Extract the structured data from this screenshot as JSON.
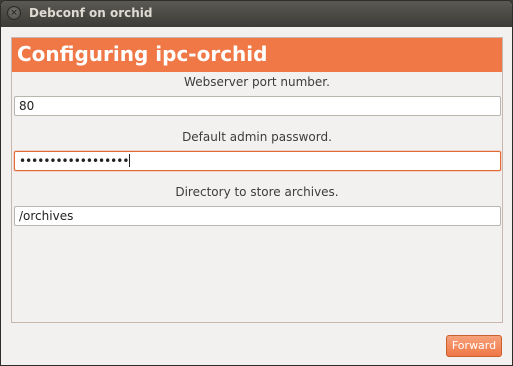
{
  "window": {
    "title": "Debconf on orchid"
  },
  "header": {
    "title": "Configuring ipc-orchid"
  },
  "fields": {
    "port": {
      "label": "Webserver port number.",
      "value": "80"
    },
    "password": {
      "label": "Default admin password.",
      "masked_value": "••••••••••••••••••"
    },
    "archives": {
      "label": "Directory to store archives.",
      "value": "/orchives"
    }
  },
  "buttons": {
    "forward_label": "Forward"
  },
  "colors": {
    "accent": "#f07746",
    "titlebar": "#3c3b37",
    "background": "#f2f1f0"
  }
}
